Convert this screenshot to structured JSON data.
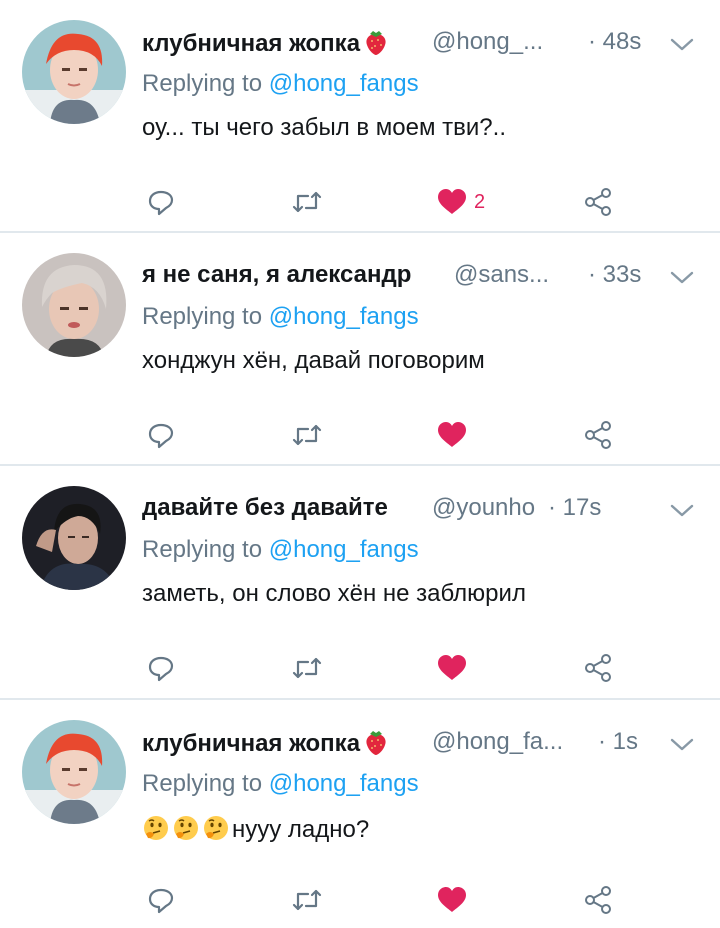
{
  "colors": {
    "accent": "#1da1f2",
    "like": "#e0245e",
    "muted": "#657786",
    "divider": "#e1e8ed"
  },
  "tweets": [
    {
      "name": "клубничная жопка",
      "name_emoji": "strawberry",
      "handle": "@hong_...",
      "time": "· 48s",
      "replying_prefix": "Replying to",
      "replying_to": "@hong_fangs",
      "text": "оу... ты чего забыл в моем тви?..",
      "liked": true,
      "like_count": "2"
    },
    {
      "name": "я не саня, я александр",
      "handle": "@sans...",
      "time": "· 33s",
      "replying_prefix": "Replying to",
      "replying_to": "@hong_fangs",
      "text": "хонджун хён, давай поговорим",
      "liked": true,
      "like_count": ""
    },
    {
      "name": "давайте без давайте",
      "handle": "@younho",
      "time": "· 17s",
      "replying_prefix": "Replying to",
      "replying_to": "@hong_fangs",
      "text": "заметь, он слово хён не заблюрил",
      "liked": true,
      "like_count": ""
    },
    {
      "name": "клубничная жопка",
      "name_emoji": "strawberry",
      "handle": "@hong_fa...",
      "time": "· 1s",
      "replying_prefix": "Replying to",
      "replying_to": "@hong_fangs",
      "text_emojis": [
        "thinking-face",
        "thinking-face",
        "thinking-face"
      ],
      "text": "нууу ладно?",
      "liked": true,
      "like_count": ""
    }
  ]
}
